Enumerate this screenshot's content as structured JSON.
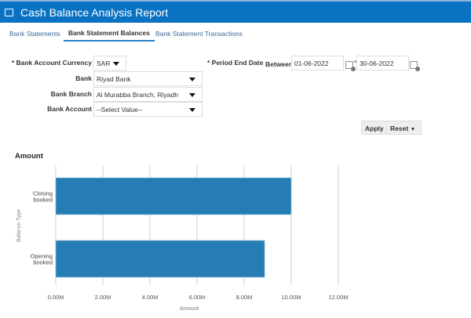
{
  "header": {
    "title": "Cash Balance Analysis Report",
    "icon": "monitor-icon",
    "color": "#0a72c2"
  },
  "tabs": [
    {
      "label": "Bank Statements",
      "active": false
    },
    {
      "label": "Bank Statement Balances",
      "active": true
    },
    {
      "label": "Bank Statement Transactions",
      "active": false
    }
  ],
  "form": {
    "currency": {
      "label": "* Bank Account Currency",
      "value": "SAR"
    },
    "bank": {
      "label": "Bank",
      "value": "Riyad Bank"
    },
    "branch": {
      "label": "Bank Branch",
      "value": "Al Murabba Branch, Riyadh"
    },
    "account": {
      "label": "Bank Account",
      "value": "--Select Value--"
    },
    "period": {
      "label": "* Period End Date",
      "between": "Between",
      "from": "01-06-2022",
      "to_req": "*",
      "to": "30-06-2022"
    }
  },
  "buttons": {
    "apply": "Apply",
    "reset": "Reset"
  },
  "chart_data": {
    "type": "bar",
    "orientation": "horizontal",
    "title": "Amount",
    "categories": [
      [
        "Closing",
        "booked"
      ],
      [
        "Opening",
        "booked"
      ]
    ],
    "values": [
      10000000,
      8870000
    ],
    "xlabel": "Amount",
    "ylabel": "Balance Type",
    "xlim": [
      0,
      12000000
    ],
    "xticks": [
      "0.00M",
      "2.00M",
      "4.00M",
      "6.00M",
      "8.00M",
      "10.00M",
      "12.00M"
    ],
    "grid": true,
    "color": "#267db3"
  }
}
